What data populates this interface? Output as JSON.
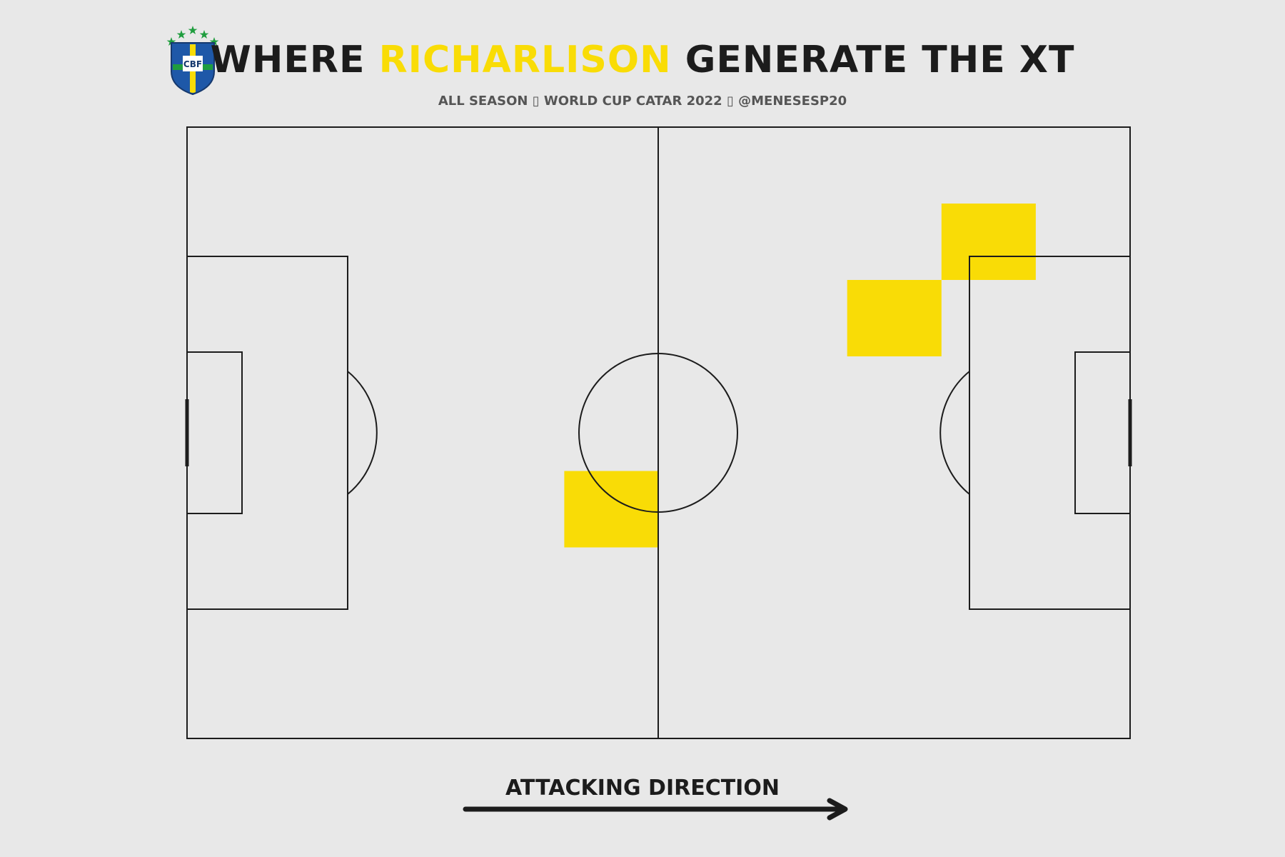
{
  "header": {
    "title_part1": "WHERE ",
    "title_player": "RICHARLISON",
    "title_part2": " GENERATE THE XT",
    "subtitle": "ALL SEASON ▯ WORLD CUP CATAR 2022 ▯ @MENESESP20",
    "logo_text": "CBF"
  },
  "footer": {
    "direction_label": "ATTACKING DIRECTION"
  },
  "colors": {
    "background": "#e8e8e8",
    "lines": "#1c1c1c",
    "highlight": "#f9dc06",
    "title": "#1c1c1c",
    "subtitle": "#555555"
  },
  "chart_data": {
    "type": "heatmap",
    "pitch": {
      "length": 120,
      "width": 80
    },
    "bin_size": {
      "x": 12,
      "y": 10
    },
    "bins": [
      {
        "x": [
          48,
          60
        ],
        "y": [
          45,
          55
        ]
      },
      {
        "x": [
          84,
          96
        ],
        "y": [
          20,
          30
        ]
      },
      {
        "x": [
          96,
          108
        ],
        "y": [
          10,
          20
        ]
      }
    ]
  }
}
